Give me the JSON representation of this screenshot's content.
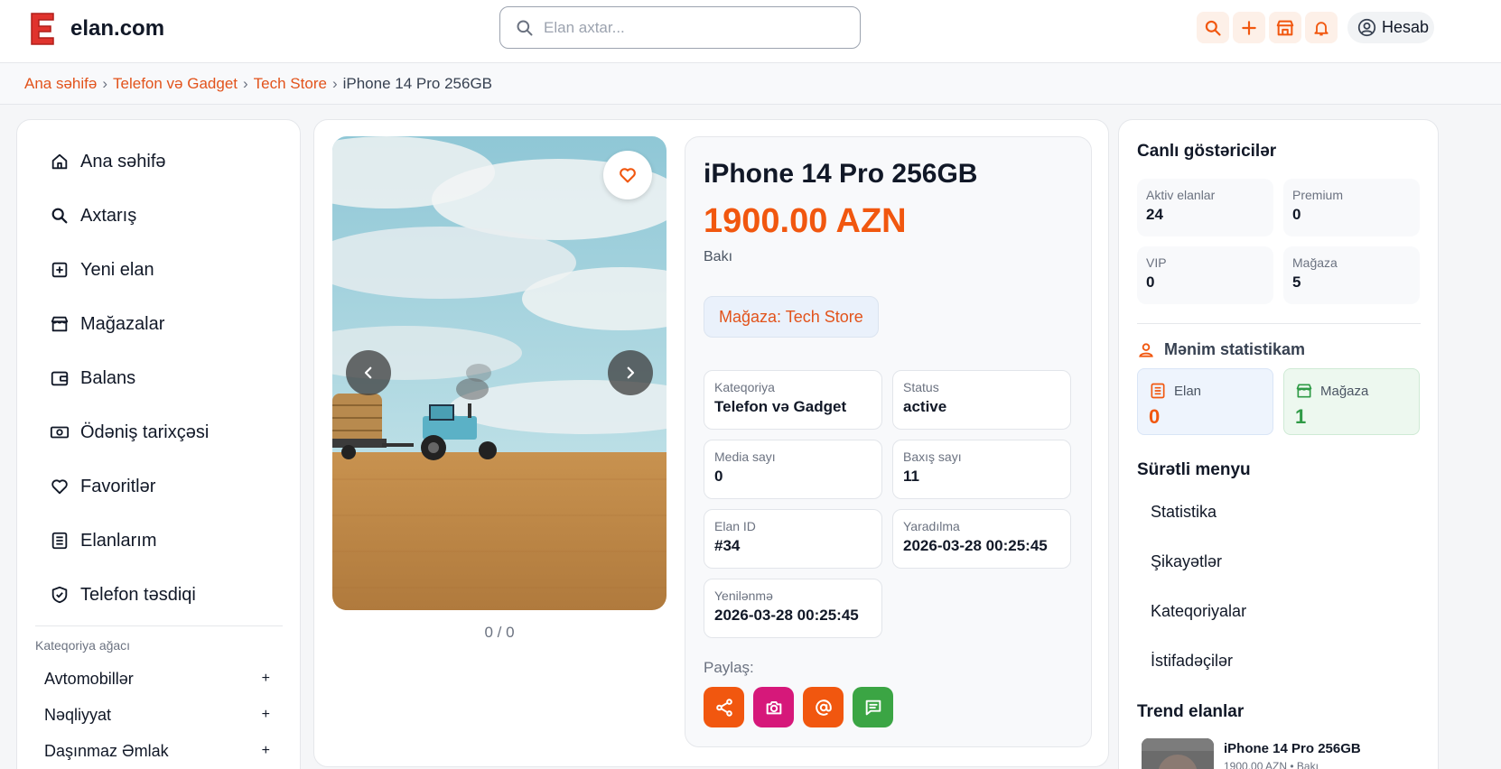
{
  "brand": {
    "logo_letter": "E",
    "name": "elan.com",
    "color": "#e0332d"
  },
  "search": {
    "placeholder": "Elan axtar..."
  },
  "toolbar": {
    "icons": [
      "search-icon",
      "plus-icon",
      "store-icon",
      "bell-icon"
    ],
    "account_label": "Hesab"
  },
  "breadcrumb": {
    "items": [
      "Ana səhifə",
      "Telefon və Gadget",
      "Tech Store"
    ],
    "current": "iPhone 14 Pro 256GB"
  },
  "sidebar": {
    "items": [
      {
        "label": "Ana səhifə",
        "icon": "home-icon"
      },
      {
        "label": "Axtarış",
        "icon": "search-icon"
      },
      {
        "label": "Yeni elan",
        "icon": "plus-square-icon"
      },
      {
        "label": "Mağazalar",
        "icon": "store-icon"
      },
      {
        "label": "Balans",
        "icon": "wallet-icon"
      },
      {
        "label": "Ödəniş tarixçəsi",
        "icon": "cash-icon"
      },
      {
        "label": "Favoritlər",
        "icon": "heart-icon"
      },
      {
        "label": "Elanlarım",
        "icon": "list-icon"
      },
      {
        "label": "Telefon təsdiqi",
        "icon": "shield-check-icon"
      }
    ],
    "category_tree_title": "Kateqoriya ağacı",
    "categories": [
      {
        "label": "Avtomobillər",
        "toggle": "+"
      },
      {
        "label": "Nəqliyyat",
        "toggle": "+"
      },
      {
        "label": "Daşınmaz Əmlak",
        "toggle": "+"
      }
    ]
  },
  "listing": {
    "title": "iPhone 14 Pro 256GB",
    "price": "1900.00 AZN",
    "city": "Bakı",
    "store_label": "Mağaza: Tech Store",
    "gallery_counter": "0 / 0",
    "details": [
      {
        "key": "Kateqoriya",
        "value": "Telefon və Gadget"
      },
      {
        "key": "Status",
        "value": "active"
      },
      {
        "key": "Media sayı",
        "value": "0"
      },
      {
        "key": "Baxış sayı",
        "value": "11"
      },
      {
        "key": "Elan ID",
        "value": "#34"
      },
      {
        "key": "Yaradılma",
        "value": "2026-03-28 00:25:45"
      },
      {
        "key": "Yenilənmə",
        "value": "2026-03-28 00:25:45"
      }
    ],
    "share_label": "Paylaş:",
    "share_buttons": [
      {
        "icon": "share-icon",
        "color": "#f1570f"
      },
      {
        "icon": "camera-icon",
        "color": "#d6187a"
      },
      {
        "icon": "at-icon",
        "color": "#f1570f"
      },
      {
        "icon": "chat-icon",
        "color": "#3ba544"
      }
    ]
  },
  "right": {
    "live_title": "Canlı göstəricilər",
    "stats": [
      {
        "key": "Aktiv elanlar",
        "value": "24"
      },
      {
        "key": "Premium",
        "value": "0"
      },
      {
        "key": "VIP",
        "value": "0"
      },
      {
        "key": "Mağaza",
        "value": "5"
      }
    ],
    "my_stats_title": "Mənim statistikam",
    "my_stats": [
      {
        "key": "Elan",
        "value": "0",
        "color": "#f1570f",
        "bg": "#eef4fd",
        "border": "#d9e5f6"
      },
      {
        "key": "Mağaza",
        "value": "1",
        "color": "#2f9a46",
        "bg": "#edf8ef",
        "border": "#cfead5"
      }
    ],
    "quick_title": "Sürətli menyu",
    "quick_items": [
      "Statistika",
      "Şikayətlər",
      "Kateqoriyalar",
      "İstifadəçilər"
    ],
    "trend_title": "Trend elanlar",
    "trend_item": {
      "title": "iPhone 14 Pro 256GB",
      "subtitle": "1900.00 AZN • Bakı"
    }
  },
  "colors": {
    "accent": "#f1570f",
    "link": "#e2531b"
  }
}
